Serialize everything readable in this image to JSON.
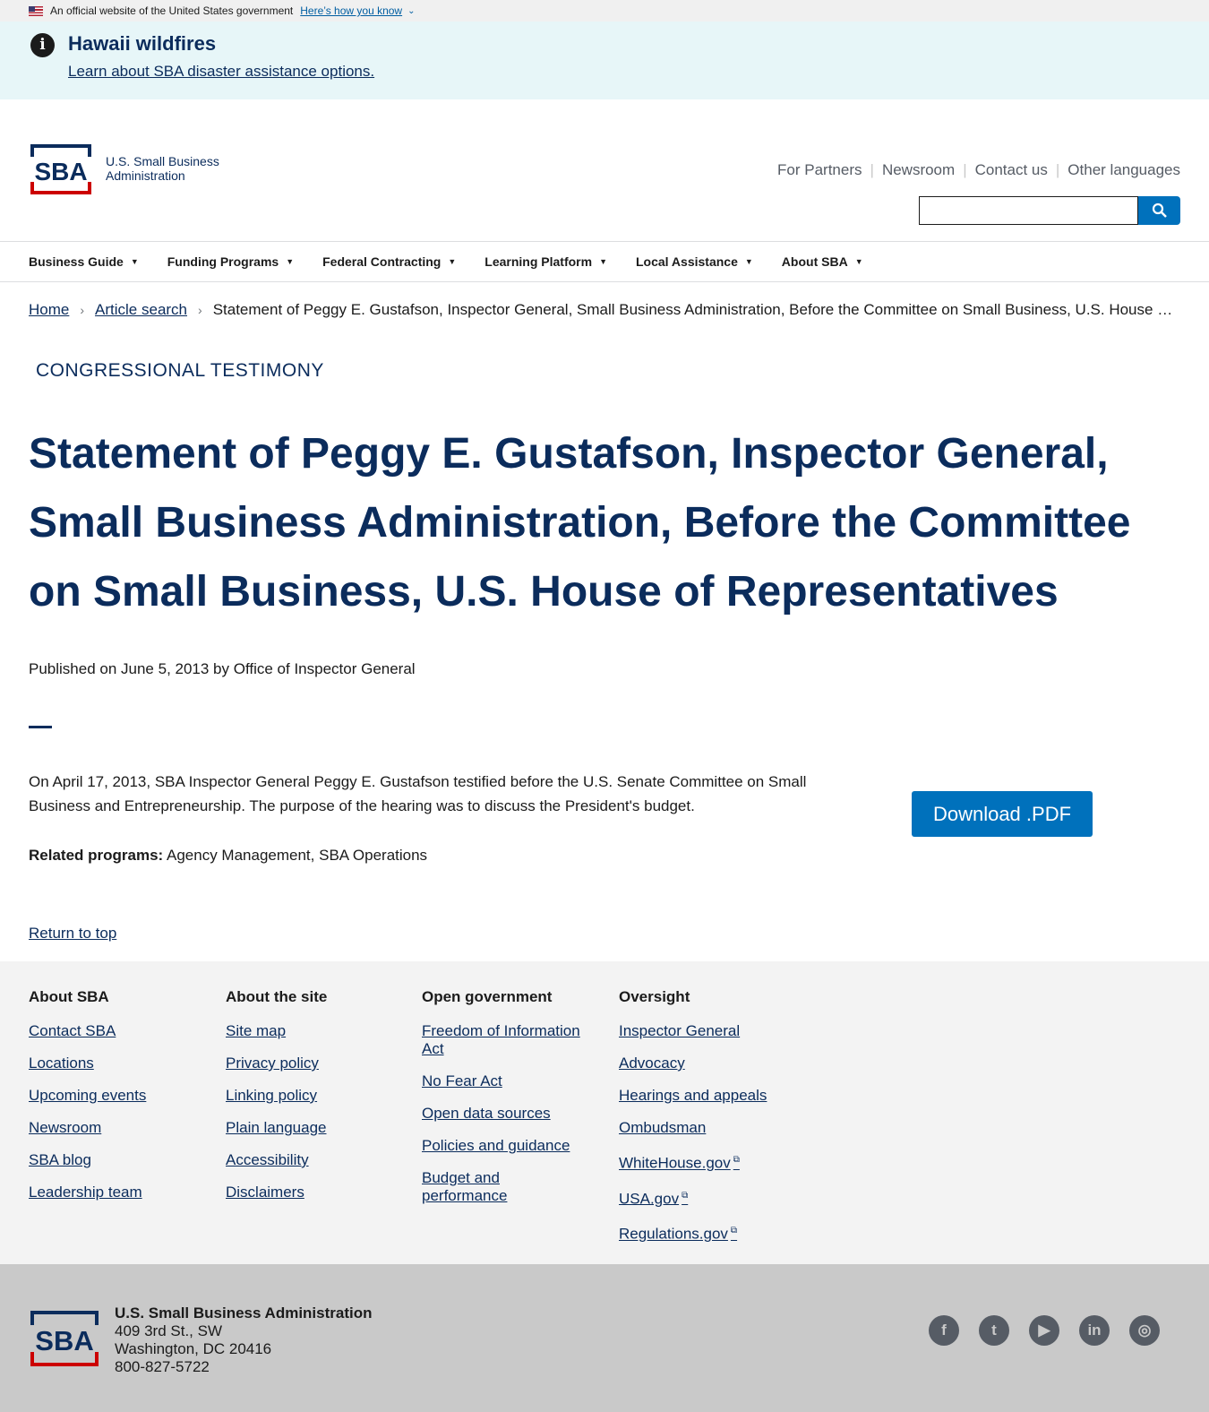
{
  "gov_banner": {
    "text": "An official website of the United States government",
    "link": "Here’s how you know"
  },
  "alert": {
    "title": "Hawaii wildfires",
    "link": "Learn about SBA disaster assistance options."
  },
  "header": {
    "logo_line1": "U.S. Small Business",
    "logo_line2": "Administration",
    "utility_links": [
      "For Partners",
      "Newsroom",
      "Contact us",
      "Other languages"
    ],
    "search_placeholder": ""
  },
  "nav": [
    "Business Guide",
    "Funding Programs",
    "Federal Contracting",
    "Learning Platform",
    "Local Assistance",
    "About SBA"
  ],
  "breadcrumb": {
    "home": "Home",
    "article_search": "Article search",
    "current": "Statement of Peggy E. Gustafson, Inspector General, Small Business Administration, Before the Committee on Small Business, U.S. House of Representatives"
  },
  "article": {
    "eyebrow": "CONGRESSIONAL TESTIMONY",
    "title": "Statement of Peggy E. Gustafson, Inspector General, Small Business Administration, Before the Committee on Small Business, U.S. House of Representatives",
    "published": "Published on June 5, 2013 by Office of Inspector General",
    "body": "On April 17, 2013,  SBA Inspector General Peggy E. Gustafson testified before the U.S. Senate Committee on Small Business and Entrepreneurship.  The purpose of the hearing was to discuss the President's budget.",
    "related_label": "Related programs:",
    "related_value": "Agency Management, SBA Operations",
    "download": "Download .PDF",
    "return_top": "Return to top"
  },
  "footer": {
    "col1": {
      "title": "About SBA",
      "links": [
        "Contact SBA",
        "Locations",
        "Upcoming events",
        "Newsroom",
        "SBA blog",
        "Leadership team"
      ]
    },
    "col2": {
      "title": "About the site",
      "links": [
        "Site map",
        "Privacy policy",
        "Linking policy",
        "Plain language",
        "Accessibility",
        "Disclaimers"
      ]
    },
    "col3": {
      "title": "Open government",
      "links": [
        "Freedom of Information Act",
        "No Fear Act",
        "Open data sources",
        "Policies and guidance",
        "Budget and performance"
      ]
    },
    "col4": {
      "title": "Oversight",
      "links": [
        "Inspector General",
        "Advocacy",
        "Hearings and appeals",
        "Ombudsman",
        "WhiteHouse.gov",
        "USA.gov",
        "Regulations.gov"
      ]
    }
  },
  "bottom": {
    "org": "U.S. Small Business Administration",
    "addr1": "409 3rd St., SW",
    "addr2": "Washington, DC 20416",
    "phone": "800-827-5722",
    "social": [
      "facebook-icon",
      "twitter-icon",
      "youtube-icon",
      "linkedin-icon",
      "instagram-icon"
    ]
  },
  "colors": {
    "navy": "#0b2c5c",
    "blue": "#0071bc",
    "alert_bg": "#e7f6f8",
    "red": "#cc0000"
  }
}
